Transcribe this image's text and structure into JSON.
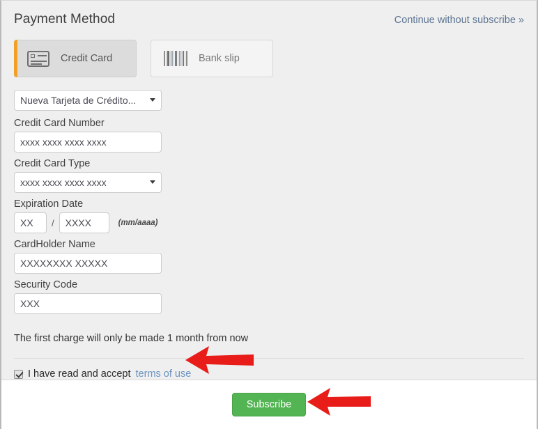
{
  "header": {
    "title": "Payment Method",
    "continue_link": "Continue without subscribe »"
  },
  "payment_methods": {
    "tabs": [
      {
        "id": "credit-card",
        "label": "Credit Card",
        "icon": "credit-card-icon",
        "active": true
      },
      {
        "id": "bank-slip",
        "label": "Bank slip",
        "icon": "barcode-icon",
        "active": false
      }
    ]
  },
  "form": {
    "saved_card_select": {
      "value": "Nueva Tarjeta de Crédito...",
      "icon": "chevron-down-icon"
    },
    "card_number": {
      "label": "Credit Card Number",
      "value": "xxxx xxxx xxxx xxxx",
      "placeholder": "xxxx xxxx xxxx xxxx"
    },
    "card_type": {
      "label": "Credit Card Type",
      "value": "xxxx xxxx xxxx xxxx",
      "icon": "chevron-down-icon"
    },
    "expiration": {
      "label": "Expiration Date",
      "month_value": "XX",
      "month_placeholder": "XX",
      "separator": "/",
      "year_value": "XXXX",
      "year_placeholder": "XXXX",
      "hint": "(mm/aaaa)"
    },
    "cardholder_name": {
      "label": "CardHolder Name",
      "value": "XXXXXXXX XXXXX",
      "placeholder": "XXXXXXXX XXXXX"
    },
    "security_code": {
      "label": "Security Code",
      "value": "XXX",
      "placeholder": "XXX"
    }
  },
  "note": "The first charge will only be made 1 month from now",
  "terms": {
    "checkbox_checked": true,
    "text": "I have read and accept",
    "link": "terms of use"
  },
  "footer": {
    "subscribe_label": "Subscribe"
  },
  "annotations": {
    "arrow_terms": "red-arrow-left-icon",
    "arrow_subscribe": "red-arrow-left-icon"
  },
  "colors": {
    "accent_orange": "#f0a026",
    "link_blue": "#5b7491",
    "terms_link_blue": "#6d94bf",
    "success_green": "#53b453",
    "annotation_red": "#e81c19",
    "page_background": "#efefef",
    "footer_background": "#ffffff"
  }
}
